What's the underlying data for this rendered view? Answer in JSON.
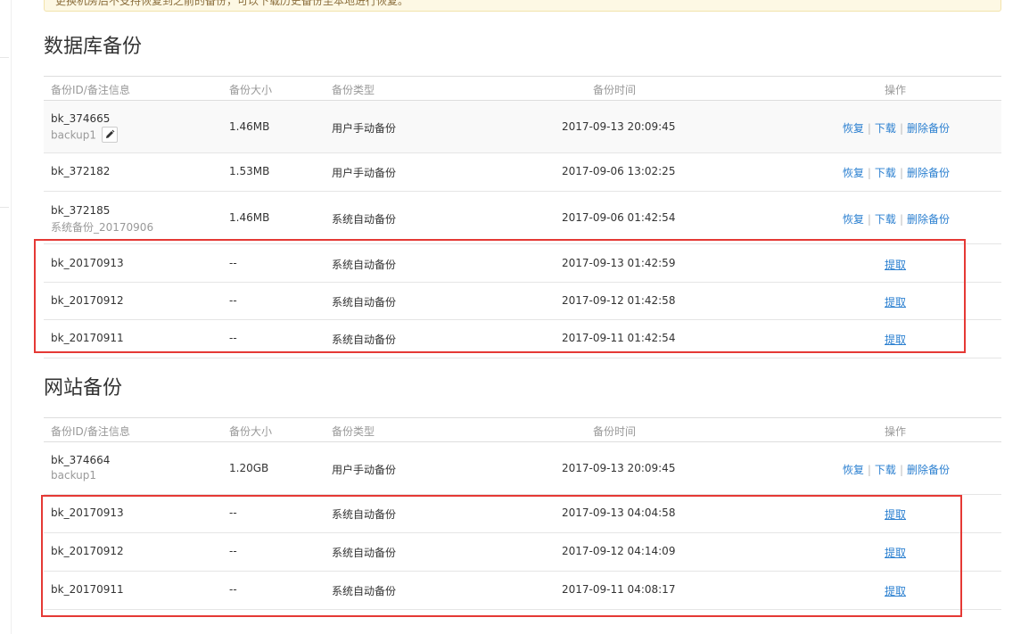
{
  "notice": {
    "text": "更换机房后不支持恢复到之前的备份，可以下载历史备份至本地进行恢复。"
  },
  "columns": {
    "id": "备份ID/备注信息",
    "size": "备份大小",
    "type": "备份类型",
    "time": "备份时间",
    "ops": "操作"
  },
  "actions": {
    "restore": "恢复",
    "download": "下载",
    "delete": "删除备份",
    "fetch": "提取"
  },
  "db": {
    "title": "数据库备份",
    "rows": [
      {
        "id": "bk_374665",
        "note": "backup1",
        "size": "1.46MB",
        "type": "用户手动备份",
        "time": "2017-09-13 20:09:45"
      },
      {
        "id": "bk_372182",
        "note": "",
        "size": "1.53MB",
        "type": "用户手动备份",
        "time": "2017-09-06 13:02:25"
      },
      {
        "id": "bk_372185",
        "note": "系统备份_20170906",
        "size": "1.46MB",
        "type": "系统自动备份",
        "time": "2017-09-06 01:42:54"
      },
      {
        "id": "bk_20170913",
        "note": "",
        "size": "--",
        "type": "系统自动备份",
        "time": "2017-09-13 01:42:59"
      },
      {
        "id": "bk_20170912",
        "note": "",
        "size": "--",
        "type": "系统自动备份",
        "time": "2017-09-12 01:42:58"
      },
      {
        "id": "bk_20170911",
        "note": "",
        "size": "--",
        "type": "系统自动备份",
        "time": "2017-09-11 01:42:54"
      }
    ]
  },
  "site": {
    "title": "网站备份",
    "rows": [
      {
        "id": "bk_374664",
        "note": "backup1",
        "size": "1.20GB",
        "type": "用户手动备份",
        "time": "2017-09-13 20:09:45"
      },
      {
        "id": "bk_20170913",
        "note": "",
        "size": "--",
        "type": "系统自动备份",
        "time": "2017-09-13 04:04:58"
      },
      {
        "id": "bk_20170912",
        "note": "",
        "size": "--",
        "type": "系统自动备份",
        "time": "2017-09-12 04:14:09"
      },
      {
        "id": "bk_20170911",
        "note": "",
        "size": "--",
        "type": "系统自动备份",
        "time": "2017-09-11 04:08:17"
      }
    ]
  },
  "colors": {
    "link": "#2a7fd0",
    "highlight": "#e53935",
    "header_text": "#999999"
  },
  "icons": {
    "edit": "pencil-icon"
  }
}
